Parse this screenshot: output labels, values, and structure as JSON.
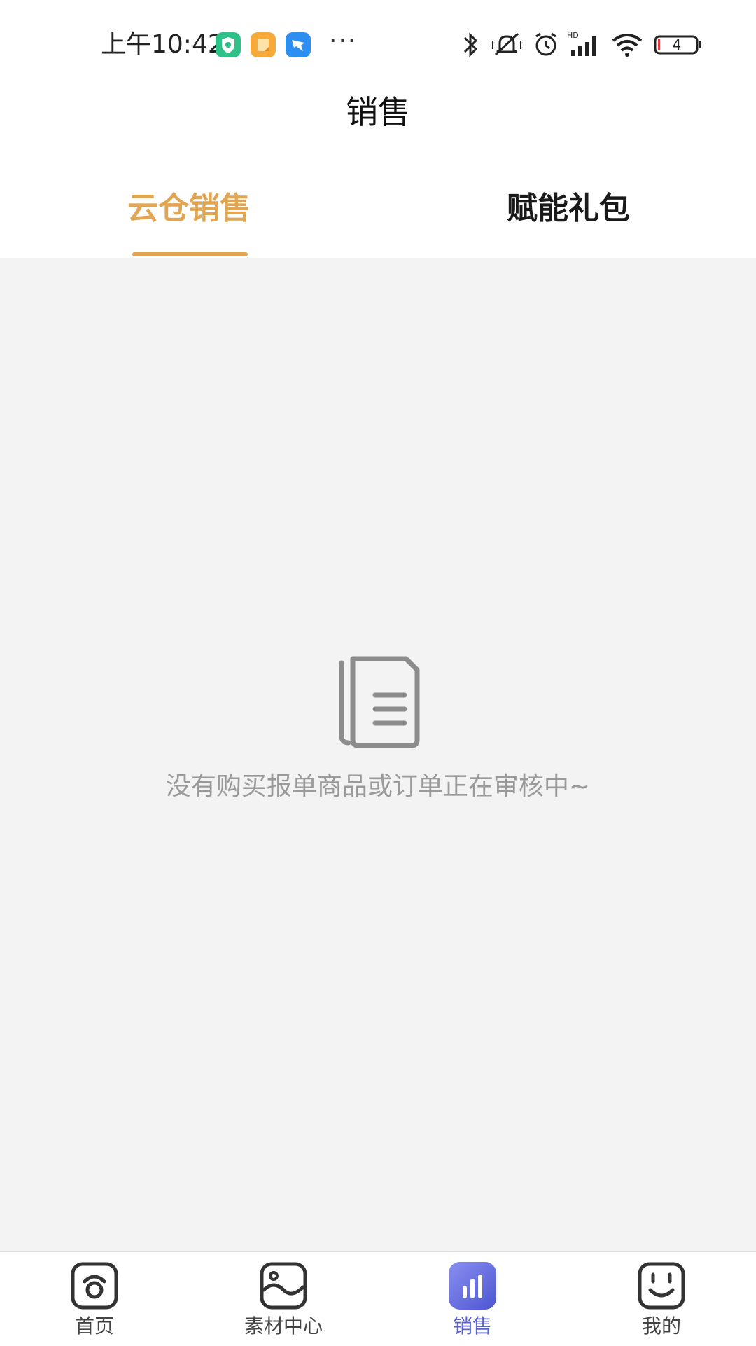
{
  "status_bar": {
    "time": "上午10:42",
    "battery": "4",
    "notification_icons": [
      "shield-app-icon",
      "note-app-icon",
      "dingtalk-app-icon"
    ],
    "more": "···"
  },
  "header": {
    "title": "销售"
  },
  "tabs": [
    {
      "label": "云仓销售",
      "active": true
    },
    {
      "label": "赋能礼包",
      "active": false
    }
  ],
  "empty_state": {
    "icon": "document-icon",
    "message": "没有购买报单商品或订单正在审核中~"
  },
  "bottom_nav": [
    {
      "label": "首页",
      "icon": "home-icon",
      "active": false
    },
    {
      "label": "素材中心",
      "icon": "image-icon",
      "active": false
    },
    {
      "label": "销售",
      "icon": "chart-icon",
      "active": true
    },
    {
      "label": "我的",
      "icon": "smile-icon",
      "active": false
    }
  ],
  "colors": {
    "accent": "#E2A552",
    "nav_active": "#5A63D8",
    "background": "#F3F3F3",
    "empty_text": "#9A9A9A"
  }
}
